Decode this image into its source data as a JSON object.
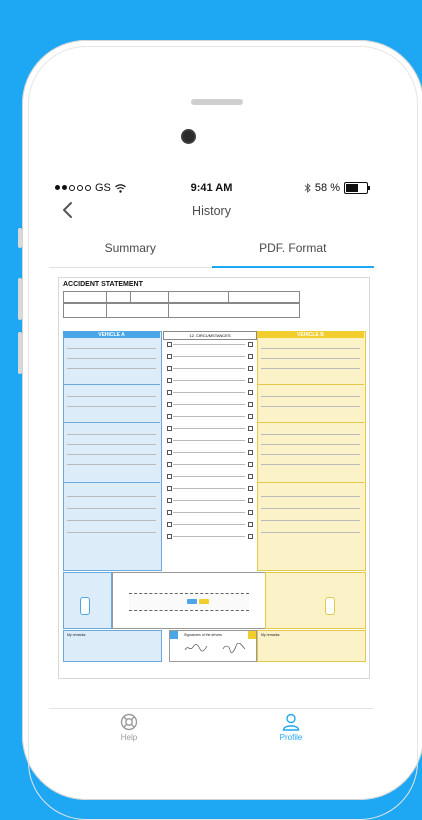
{
  "status": {
    "carrier": "GS",
    "time": "9:41 AM",
    "battery": "58 %"
  },
  "nav": {
    "title": "History"
  },
  "tabs": [
    {
      "label": "Summary",
      "active": false
    },
    {
      "label": "PDF. Format",
      "active": true
    }
  ],
  "document": {
    "title": "ACCIDENT STATEMENT",
    "vehicle_a": "VEHICLE A",
    "vehicle_b": "VEHICLE B",
    "circumstances": "12. CIRCUMSTANCES",
    "remarks_label": "My remarks:",
    "signatures_label": "Signatures of the drivers"
  },
  "bottom_tabs": [
    {
      "label": "Help",
      "active": false
    },
    {
      "label": "Profile",
      "active": true
    }
  ],
  "colors": {
    "accent": "#1ea7f2",
    "vehicle_a": "#4aa6e6",
    "vehicle_b": "#f1cd2e",
    "inactive": "#9a9a9a"
  }
}
